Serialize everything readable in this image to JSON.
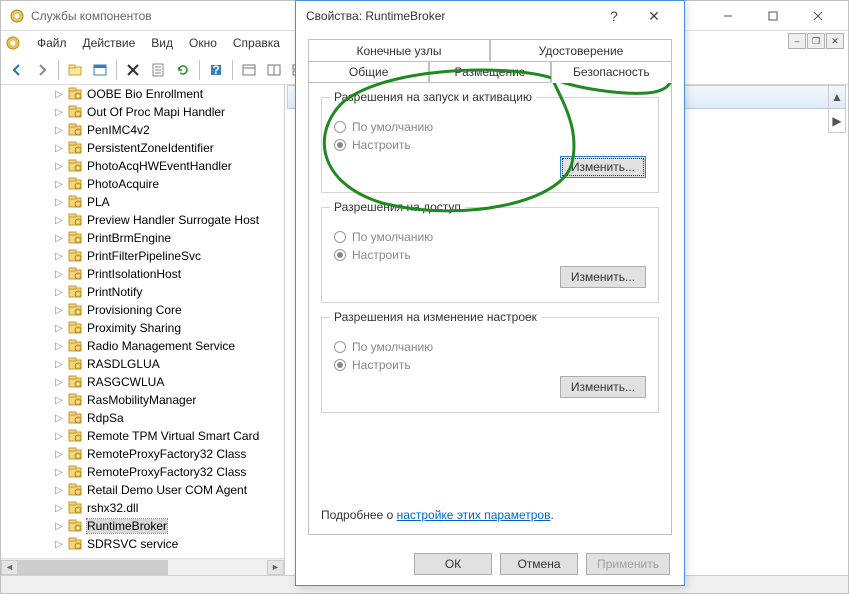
{
  "window": {
    "title": "Службы компонентов",
    "menus": [
      "Файл",
      "Действие",
      "Вид",
      "Окно",
      "Справка"
    ]
  },
  "tree": {
    "items": [
      {
        "label": "OOBE Bio Enrollment",
        "expandable": true
      },
      {
        "label": "Out Of Proc Mapi Handler",
        "expandable": true
      },
      {
        "label": "PenIMC4v2",
        "expandable": true
      },
      {
        "label": "PersistentZoneIdentifier",
        "expandable": true
      },
      {
        "label": "PhotoAcqHWEventHandler",
        "expandable": true
      },
      {
        "label": "PhotoAcquire",
        "expandable": true
      },
      {
        "label": "PLA",
        "expandable": true
      },
      {
        "label": "Preview Handler Surrogate Host",
        "expandable": true
      },
      {
        "label": "PrintBrmEngine",
        "expandable": true
      },
      {
        "label": "PrintFilterPipelineSvc",
        "expandable": true
      },
      {
        "label": "PrintIsolationHost",
        "expandable": true
      },
      {
        "label": "PrintNotify",
        "expandable": true
      },
      {
        "label": "Provisioning Core",
        "expandable": true
      },
      {
        "label": "Proximity Sharing",
        "expandable": true
      },
      {
        "label": "Radio Management Service",
        "expandable": true
      },
      {
        "label": "RASDLGLUA",
        "expandable": true
      },
      {
        "label": "RASGCWLUA",
        "expandable": true
      },
      {
        "label": "RasMobilityManager",
        "expandable": true
      },
      {
        "label": "RdpSa",
        "expandable": true
      },
      {
        "label": "Remote TPM Virtual Smart Card",
        "expandable": true
      },
      {
        "label": "RemoteProxyFactory32 Class",
        "expandable": true
      },
      {
        "label": "RemoteProxyFactory32 Class",
        "expandable": true
      },
      {
        "label": "Retail Demo User COM Agent",
        "expandable": true
      },
      {
        "label": "rshx32.dll",
        "expandable": true
      },
      {
        "label": "RuntimeBroker",
        "expandable": true,
        "selected": true
      },
      {
        "label": "SDRSVC service",
        "expandable": true
      }
    ]
  },
  "dialog": {
    "title": "Свойства: RuntimeBroker",
    "tabs_row1": [
      "Конечные узлы",
      "Удостоверение"
    ],
    "tabs_row2": [
      "Общие",
      "Размещение",
      "Безопасность"
    ],
    "active_tab": "Безопасность",
    "groups": {
      "launch": {
        "title": "Разрешения на запуск и активацию",
        "opt_default": "По умолчанию",
        "opt_custom": "Настроить",
        "btn": "Изменить..."
      },
      "access": {
        "title": "Разрешения на доступ",
        "opt_default": "По умолчанию",
        "opt_custom": "Настроить",
        "btn": "Изменить..."
      },
      "config": {
        "title": "Разрешения на изменение настроек",
        "opt_default": "По умолчанию",
        "opt_custom": "Настроить",
        "btn": "Изменить..."
      }
    },
    "info_prefix": "Подробнее о ",
    "info_link": "настройке этих параметров",
    "buttons": {
      "ok": "ОК",
      "cancel": "Отмена",
      "apply": "Применить"
    }
  }
}
